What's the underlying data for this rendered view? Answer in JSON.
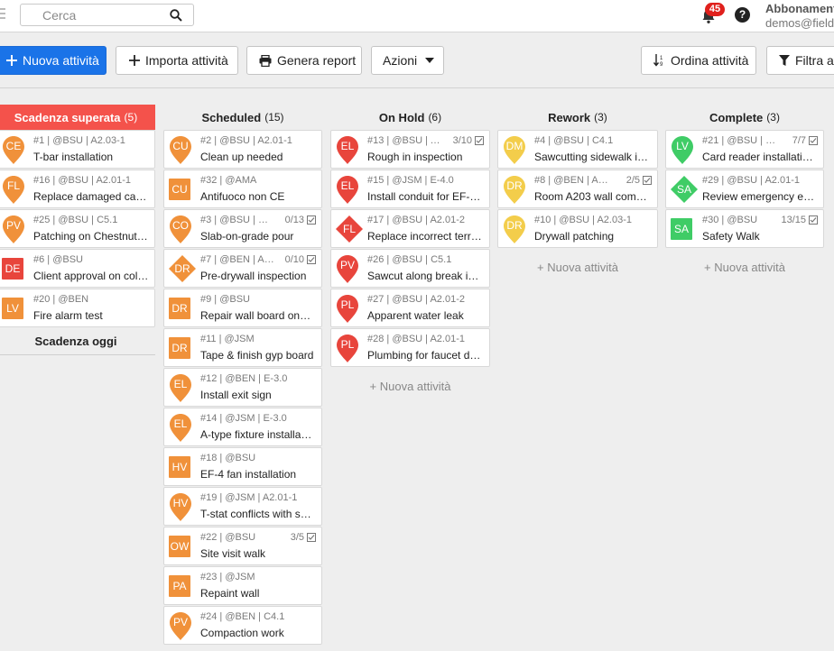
{
  "header": {
    "search_placeholder": "Cerca",
    "notifications_count": "45",
    "help_label": "?",
    "account_title": "Abbonamento",
    "account_email": "demos@fieldwire.net"
  },
  "toolbar": {
    "new_task": "Nuova attività",
    "import_tasks": "Importa attività",
    "generate_report": "Genera report",
    "actions": "Azioni",
    "sort_tasks": "Ordina attività",
    "filter_tasks": "Filtra attività"
  },
  "colors": {
    "orange": "#f0913a",
    "red": "#e8453c",
    "yellow": "#f3cd4b",
    "green": "#3fcc66",
    "primary": "#1a73e8",
    "overdue_header": "#f4524b"
  },
  "columns": [
    {
      "title": "Scadenza superata",
      "count": "(5)",
      "cards": [
        {
          "initials": "CE",
          "shape": "pin",
          "color": "orange",
          "meta": "#1 | @BSU | A2.03-1",
          "title": "T-bar installation",
          "check": ""
        },
        {
          "initials": "FL",
          "shape": "pin",
          "color": "orange",
          "meta": "#16 | @BSU | A2.01-1",
          "title": "Replace damaged car…",
          "check": ""
        },
        {
          "initials": "PV",
          "shape": "pin",
          "color": "orange",
          "meta": "#25 | @BSU | C5.1",
          "title": "Patching on Chestnut…",
          "check": ""
        },
        {
          "initials": "DE",
          "shape": "square",
          "color": "red",
          "meta": "#6 | @BSU",
          "title": "Client approval on col…",
          "check": ""
        },
        {
          "initials": "LV",
          "shape": "square",
          "color": "orange",
          "meta": "#20 | @BEN",
          "title": "Fire alarm test",
          "check": ""
        }
      ],
      "today_title": "Scadenza oggi"
    },
    {
      "title": "Scheduled",
      "count": "(15)",
      "cards": [
        {
          "initials": "CU",
          "shape": "pin",
          "color": "orange",
          "meta": "#2 | @BSU | A2.01-1",
          "title": "Clean up needed",
          "check": ""
        },
        {
          "initials": "CU",
          "shape": "square",
          "color": "orange",
          "meta": "#32 | @AMA",
          "title": "Antifuoco non CE",
          "check": ""
        },
        {
          "initials": "CO",
          "shape": "pin",
          "color": "orange",
          "meta": "#3 | @BSU | S2....",
          "title": "Slab-on-grade pour",
          "check": "0/13"
        },
        {
          "initials": "DR",
          "shape": "diamond",
          "color": "orange",
          "meta": "#7 | @BEN | A2....",
          "title": "Pre-drywall inspection",
          "check": "0/10"
        },
        {
          "initials": "DR",
          "shape": "square",
          "color": "orange",
          "meta": "#9 | @BSU",
          "title": "Repair wall board onc…",
          "check": ""
        },
        {
          "initials": "DR",
          "shape": "square",
          "color": "orange",
          "meta": "#11 | @JSM",
          "title": "Tape & finish gyp board",
          "check": ""
        },
        {
          "initials": "EL",
          "shape": "pin",
          "color": "orange",
          "meta": "#12 | @BEN | E-3.0",
          "title": "Install exit sign",
          "check": ""
        },
        {
          "initials": "EL",
          "shape": "pin",
          "color": "orange",
          "meta": "#14 | @JSM | E-3.0",
          "title": "A-type fixture installa…",
          "check": ""
        },
        {
          "initials": "HV",
          "shape": "square",
          "color": "orange",
          "meta": "#18 | @BSU",
          "title": "EF-4 fan installation",
          "check": ""
        },
        {
          "initials": "HV",
          "shape": "pin",
          "color": "orange",
          "meta": "#19 | @JSM | A2.01-1",
          "title": "T-stat conflicts with s…",
          "check": ""
        },
        {
          "initials": "OW",
          "shape": "square",
          "color": "orange",
          "meta": "#22 | @BSU",
          "title": "Site visit walk",
          "check": "3/5"
        },
        {
          "initials": "PA",
          "shape": "square",
          "color": "orange",
          "meta": "#23 | @JSM",
          "title": "Repaint wall",
          "check": ""
        },
        {
          "initials": "PV",
          "shape": "pin",
          "color": "orange",
          "meta": "#24 | @BEN | C4.1",
          "title": "Compaction work",
          "check": ""
        }
      ]
    },
    {
      "title": "On Hold",
      "count": "(6)",
      "cards": [
        {
          "initials": "EL",
          "shape": "pin",
          "color": "red",
          "meta": "#13 | @BSU | A…",
          "title": "Rough in inspection",
          "check": "3/10"
        },
        {
          "initials": "EL",
          "shape": "pin",
          "color": "red",
          "meta": "#15 | @JSM | E-4.0",
          "title": "Install conduit for EF-…",
          "check": ""
        },
        {
          "initials": "FL",
          "shape": "diamond",
          "color": "red",
          "meta": "#17 | @BSU | A2.01-2",
          "title": "Replace incorrect terr…",
          "check": ""
        },
        {
          "initials": "PV",
          "shape": "pin",
          "color": "red",
          "meta": "#26 | @BSU | C5.1",
          "title": "Sawcut along break in…",
          "check": ""
        },
        {
          "initials": "PL",
          "shape": "pin",
          "color": "red",
          "meta": "#27 | @BSU | A2.01-2",
          "title": "Apparent water leak",
          "check": ""
        },
        {
          "initials": "PL",
          "shape": "pin",
          "color": "red",
          "meta": "#28 | @BSU | A2.01-1",
          "title": "Plumbing for faucet d…",
          "check": ""
        }
      ],
      "add_label": "+ Nuova attività"
    },
    {
      "title": "Rework",
      "count": "(3)",
      "cards": [
        {
          "initials": "DM",
          "shape": "pin",
          "color": "yellow",
          "meta": "#4 | @BSU | C4.1",
          "title": "Sawcutting sidewalk i…",
          "check": ""
        },
        {
          "initials": "DR",
          "shape": "pin",
          "color": "yellow",
          "meta": "#8 | @BEN | A2...",
          "title": "Room A203 wall com…",
          "check": "2/5"
        },
        {
          "initials": "DR",
          "shape": "pin",
          "color": "yellow",
          "meta": "#10 | @BSU | A2.03-1",
          "title": "Drywall patching",
          "check": ""
        }
      ],
      "add_label": "+ Nuova attività"
    },
    {
      "title": "Complete",
      "count": "(3)",
      "cards": [
        {
          "initials": "LV",
          "shape": "pin",
          "color": "green",
          "meta": "#21 | @BSU | E...",
          "title": "Card reader installati…",
          "check": "7/7"
        },
        {
          "initials": "SA",
          "shape": "diamond",
          "color": "green",
          "meta": "#29 | @BSU | A2.01-1",
          "title": "Review emergency eg…",
          "check": ""
        },
        {
          "initials": "SA",
          "shape": "square",
          "color": "green",
          "meta": "#30 | @BSU",
          "title": "Safety Walk",
          "check": "13/15"
        }
      ],
      "add_label": "+ Nuova attività"
    }
  ]
}
